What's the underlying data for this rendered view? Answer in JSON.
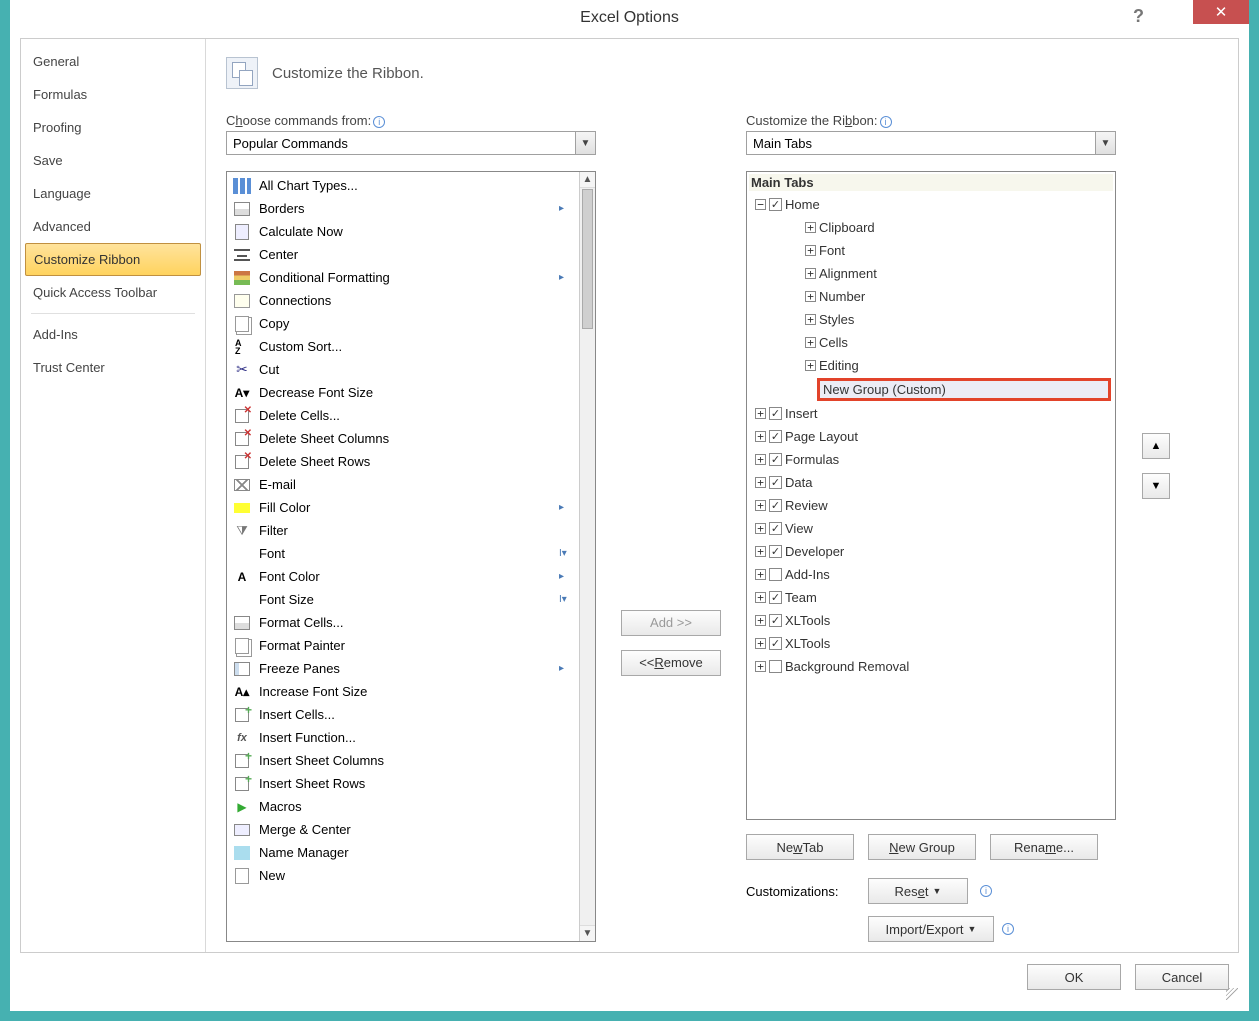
{
  "title": "Excel Options",
  "sidebar": {
    "items": [
      {
        "label": "General"
      },
      {
        "label": "Formulas"
      },
      {
        "label": "Proofing"
      },
      {
        "label": "Save"
      },
      {
        "label": "Language"
      },
      {
        "label": "Advanced"
      },
      {
        "label": "Customize Ribbon",
        "selected": true
      },
      {
        "label": "Quick Access Toolbar"
      },
      {
        "sep": true
      },
      {
        "label": "Add-Ins"
      },
      {
        "label": "Trust Center"
      }
    ]
  },
  "header": {
    "title": "Customize the Ribbon."
  },
  "left": {
    "label_pre": "C",
    "label_u": "h",
    "label_post": "oose commands from:",
    "dropdown": "Popular Commands"
  },
  "right": {
    "label_pre": "Customize the Ri",
    "label_u": "b",
    "label_post": "bon:",
    "dropdown": "Main Tabs"
  },
  "commands": [
    {
      "label": "All Chart Types...",
      "icon": "i-chart"
    },
    {
      "label": "Borders",
      "icon": "i-grid",
      "sub": true
    },
    {
      "label": "Calculate Now",
      "icon": "i-calc"
    },
    {
      "label": "Center",
      "icon": "i-center"
    },
    {
      "label": "Conditional Formatting",
      "icon": "i-cond",
      "sub": true
    },
    {
      "label": "Connections",
      "icon": "i-conn"
    },
    {
      "label": "Copy",
      "icon": "i-copy"
    },
    {
      "label": "Custom Sort...",
      "icon": "i-sort"
    },
    {
      "label": "Cut",
      "icon": "i-cut",
      "glyph": "✂"
    },
    {
      "label": "Decrease Font Size",
      "icon": "i-fontdn",
      "glyph": "A▾"
    },
    {
      "label": "Delete Cells...",
      "icon": "i-delcell"
    },
    {
      "label": "Delete Sheet Columns",
      "icon": "i-delcell"
    },
    {
      "label": "Delete Sheet Rows",
      "icon": "i-delcell"
    },
    {
      "label": "E-mail",
      "icon": "i-email"
    },
    {
      "label": "Fill Color",
      "icon": "i-fill",
      "sub": true
    },
    {
      "label": "Filter",
      "icon": "i-filter",
      "glyph": "⧩"
    },
    {
      "label": "Font",
      "icon": "",
      "sub": true,
      "subglyph": "I▾"
    },
    {
      "label": "Font Color",
      "icon": "i-fontdn",
      "glyph": "A",
      "sub": true
    },
    {
      "label": "Font Size",
      "icon": "",
      "sub": true,
      "subglyph": "I▾"
    },
    {
      "label": "Format Cells...",
      "icon": "i-grid"
    },
    {
      "label": "Format Painter",
      "icon": "i-copy"
    },
    {
      "label": "Freeze Panes",
      "icon": "i-freeze",
      "sub": true
    },
    {
      "label": "Increase Font Size",
      "icon": "i-fontup",
      "glyph": "A▴"
    },
    {
      "label": "Insert Cells...",
      "icon": "i-insert"
    },
    {
      "label": "Insert Function...",
      "icon": "i-fx",
      "glyph": "fx"
    },
    {
      "label": "Insert Sheet Columns",
      "icon": "i-insert"
    },
    {
      "label": "Insert Sheet Rows",
      "icon": "i-insert"
    },
    {
      "label": "Macros",
      "icon": "i-macro",
      "glyph": "▶"
    },
    {
      "label": "Merge & Center",
      "icon": "i-merge"
    },
    {
      "label": "Name Manager",
      "icon": "i-name"
    },
    {
      "label": "New",
      "icon": "i-new"
    }
  ],
  "tree": {
    "root_label": "Main Tabs",
    "home": {
      "label": "Home",
      "expanded": true,
      "checked": true,
      "groups": [
        {
          "label": "Clipboard"
        },
        {
          "label": "Font"
        },
        {
          "label": "Alignment"
        },
        {
          "label": "Number"
        },
        {
          "label": "Styles"
        },
        {
          "label": "Cells"
        },
        {
          "label": "Editing"
        }
      ],
      "highlight": "New Group (Custom)"
    },
    "tabs": [
      {
        "label": "Insert",
        "checked": true
      },
      {
        "label": "Page Layout",
        "checked": true
      },
      {
        "label": "Formulas",
        "checked": true
      },
      {
        "label": "Data",
        "checked": true
      },
      {
        "label": "Review",
        "checked": true
      },
      {
        "label": "View",
        "checked": true
      },
      {
        "label": "Developer",
        "checked": true
      },
      {
        "label": "Add-Ins",
        "checked": false
      },
      {
        "label": "Team",
        "checked": true
      },
      {
        "label": "XLTools",
        "checked": true
      },
      {
        "label": "XLTools",
        "checked": true
      },
      {
        "label": "Background Removal",
        "checked": false
      }
    ]
  },
  "mid_buttons": {
    "add": "Add >>",
    "remove_pre": "<< ",
    "remove_u": "R",
    "remove_post": "emove"
  },
  "right_buttons": {
    "newtab_pre": "Ne",
    "newtab_u": "w",
    "newtab_post": " Tab",
    "newgroup_u": "N",
    "newgroup_post": "ew Group",
    "rename_pre": "Rena",
    "rename_u": "m",
    "rename_post": "e..."
  },
  "custom_row": {
    "label": "Customizations:",
    "reset_pre": "Res",
    "reset_u": "e",
    "reset_post": "t",
    "ie_pre": "Import/Export"
  },
  "bottom": {
    "ok": "OK",
    "cancel": "Cancel"
  }
}
